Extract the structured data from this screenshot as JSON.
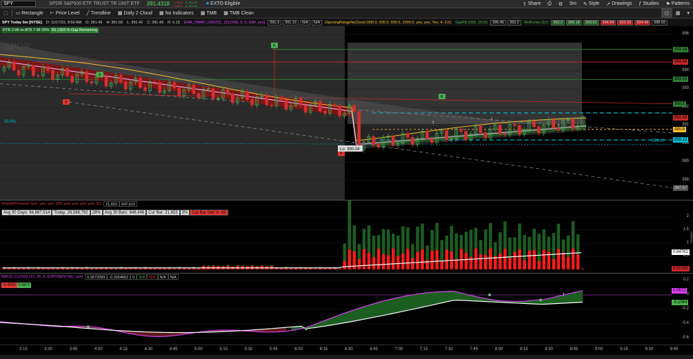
{
  "topbar": {
    "symbol": "SPY",
    "description": "SPDR S&P500 ETF TRUST TR UNIT ETF",
    "last_price": "391.4318",
    "change1": "-3.4082",
    "change2": "-0.86%",
    "bid": "B: 391.43",
    "ask": "A: 391.44",
    "badge": "EXTO Eligible",
    "share": "Share",
    "style": "Style",
    "drawings": "Drawings",
    "studies": "Studies",
    "patterns": "Patterns"
  },
  "toolbar": {
    "items": [
      "Rectangle",
      "Price Level",
      "Trendline",
      "Daily 2 Cloud",
      "No Indicators",
      "TMB",
      "TMB Clean"
    ]
  },
  "studybar": {
    "chart_label": "SPY Today 5m [NYSE]",
    "date": "D: 11/17/22, 8:50 AM",
    "open": "O: 391.49",
    "high": "H: 391.55",
    "low": "L: 391.42",
    "close": "C: 391.43",
    "range": "R: 0.13",
    "study1": "EMA_VWAP_CROSS_ (CLOSE, 9, 0, DAY, yes)",
    "study1_v1": "391.3",
    "study1_v2": "391.13",
    "study1_v3": "N/A",
    "study1_v4": "N/A",
    "study2": "OpeningRangeNoCloud (930.0, 935.0, 930.0, 1000.0, yes, yes, Yes, 4, 2.0)",
    "study3": "GapFill (930, 1615)",
    "study3_v1": "395.45",
    "study3_v2": "392.2",
    "study4": "WolfLines (10)",
    "study4_v1": "392.2",
    "study4_v2": "395.18",
    "study4_v3": "393.53",
    "study4_v4": "394.94",
    "study4_v5": "392.93",
    "study4_v6": "394.49",
    "study4_v7": "388.03",
    "dtr": "DTR 2.06 vs ATR 7.98  26%",
    "gap": "65.1303 % Gap Remaining"
  },
  "price_panel": {
    "watermark": "SPDR",
    "pct_label": "23.6%",
    "lo_label": "Lo: 390.04",
    "fib_label": "389.97",
    "markers": [
      "R",
      "R",
      "R",
      "R"
    ],
    "y_ticks": [
      "396",
      "395",
      "394",
      "393",
      "392",
      "391",
      "390",
      "389",
      "388"
    ],
    "tags": [
      {
        "v": "395.18",
        "color": "#2e7d32"
      },
      {
        "v": "394.49",
        "color": "#c62828"
      },
      {
        "v": "393.53",
        "color": "#2e7d32"
      },
      {
        "v": "392.2",
        "color": "#2e7d32"
      },
      {
        "v": "391.43",
        "color": "#c62828"
      },
      {
        "v": "390.8",
        "color": "#fbc02d"
      },
      {
        "v": "390.22",
        "color": "#00bcd4"
      },
      {
        "v": "387.57",
        "color": "#555"
      }
    ]
  },
  "volume_panel": {
    "study": "VolumePressure (yes, yes, yes, 300, yes, yes, yes, yes, 30)",
    "study_v1": "21,653",
    "study_v2": "647,610",
    "avg30": "Avg 30 Days: 94,887,514",
    "today": "Today: 26,588,792",
    "today_pct": "28%",
    "avg30bars": "Avg 30 Bars: 648,446",
    "curbar": "Cur Bar: 21,653",
    "curbar_pct": "3%",
    "cur_sell": "Cur Bar Sell %: 85",
    "y_ticks": [
      "2",
      "1.5",
      "1",
      "0.5"
    ],
    "y_unit": "millions",
    "tags": [
      {
        "v": "0.64761",
        "color": "#fff"
      },
      {
        "v": "0.02165",
        "color": "#c62828"
      }
    ]
  },
  "macd_panel": {
    "study": "MACD_CLOUD (12, 26, 9, EXPONENTIAL, yes)",
    "v1": "0.0572099",
    "v2": "-0.0264652",
    "v3": "0",
    "v4": "N/A",
    "v5": "N/A",
    "v6": "N/A",
    "v7": "N/A",
    "left_tag1": "-0.4069",
    "left_tag2": "0.0872",
    "y_ticks": [
      "0.2",
      "0",
      "-0.2",
      "-0.4",
      "-0.6"
    ],
    "tags": [
      {
        "v": "0.0572",
        "color": "#e040fb"
      },
      {
        "v": "-0.1064",
        "color": "#4caf50"
      }
    ]
  },
  "time_axis": [
    "3:15",
    "3:30",
    "3:45",
    "4:00",
    "4:15",
    "4:30",
    "4:45",
    "5:00",
    "5:15",
    "5:30",
    "5:45",
    "6:00",
    "6:15",
    "6:30",
    "6:45",
    "7:00",
    "7:15",
    "7:30",
    "7:45",
    "8:00",
    "8:15",
    "8:30",
    "8:45",
    "9:00",
    "9:15",
    "9:30",
    "9:45"
  ]
}
